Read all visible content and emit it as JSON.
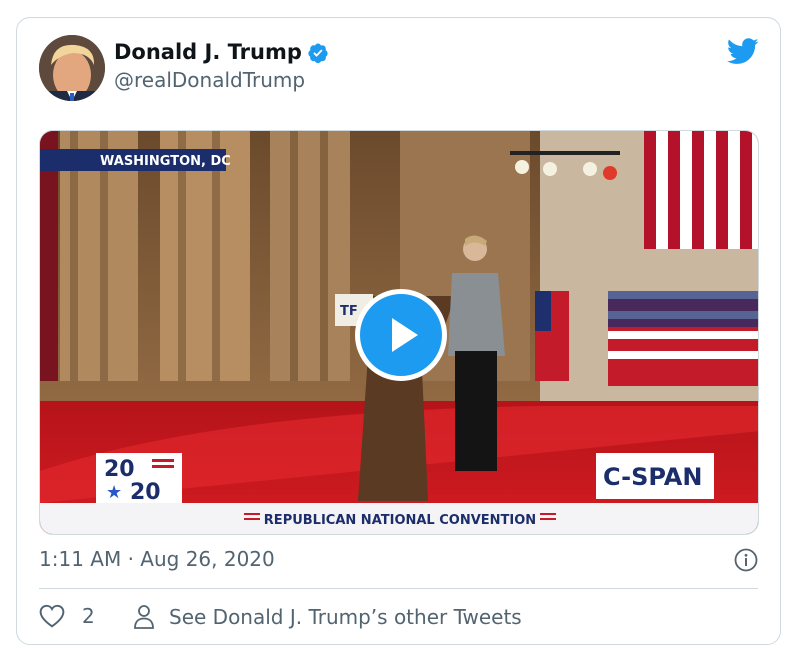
{
  "tweet": {
    "author_name": "Donald J. Trump",
    "handle": "@realDonaldTrump",
    "timestamp": "1:11 AM · Aug 26, 2020",
    "like_count": "2",
    "other_tweets_label": "See Donald J. Trump’s other Tweets"
  },
  "video": {
    "location_label": "WASHINGTON, DC",
    "badge_top": "20",
    "badge_bottom": "20",
    "network_logo": "C-SPAN",
    "banner": "REPUBLICAN NATIONAL CONVENTION",
    "podium_text": "TF"
  },
  "icons": [
    "verified-badge-icon",
    "twitter-bird-icon",
    "play-icon",
    "info-icon",
    "heart-icon",
    "person-icon"
  ],
  "colors": {
    "accent": "#1d9bf0",
    "muted_text": "#536471",
    "border": "#cfd9de",
    "stage_red": "#c8141b"
  }
}
